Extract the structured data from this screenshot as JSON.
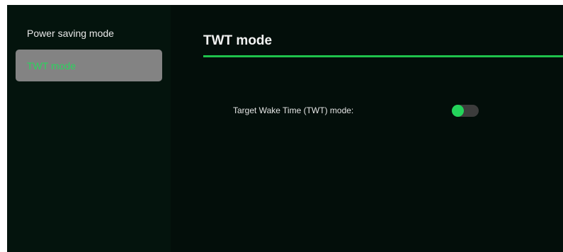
{
  "sidebar": {
    "items": [
      {
        "label": "Power saving mode",
        "active": false
      },
      {
        "label": "TWT mode",
        "active": true
      }
    ]
  },
  "main": {
    "title": "TWT mode",
    "settings": [
      {
        "label": "Target Wake Time (TWT) mode:",
        "toggle_state": "off"
      }
    ]
  },
  "colors": {
    "accent": "#1fc14c",
    "active_item_bg": "#838383",
    "background": "#030e0a",
    "sidebar_bg": "#04140d",
    "toggle_track": "#3c3c3c",
    "toggle_knob": "#23d35a"
  }
}
